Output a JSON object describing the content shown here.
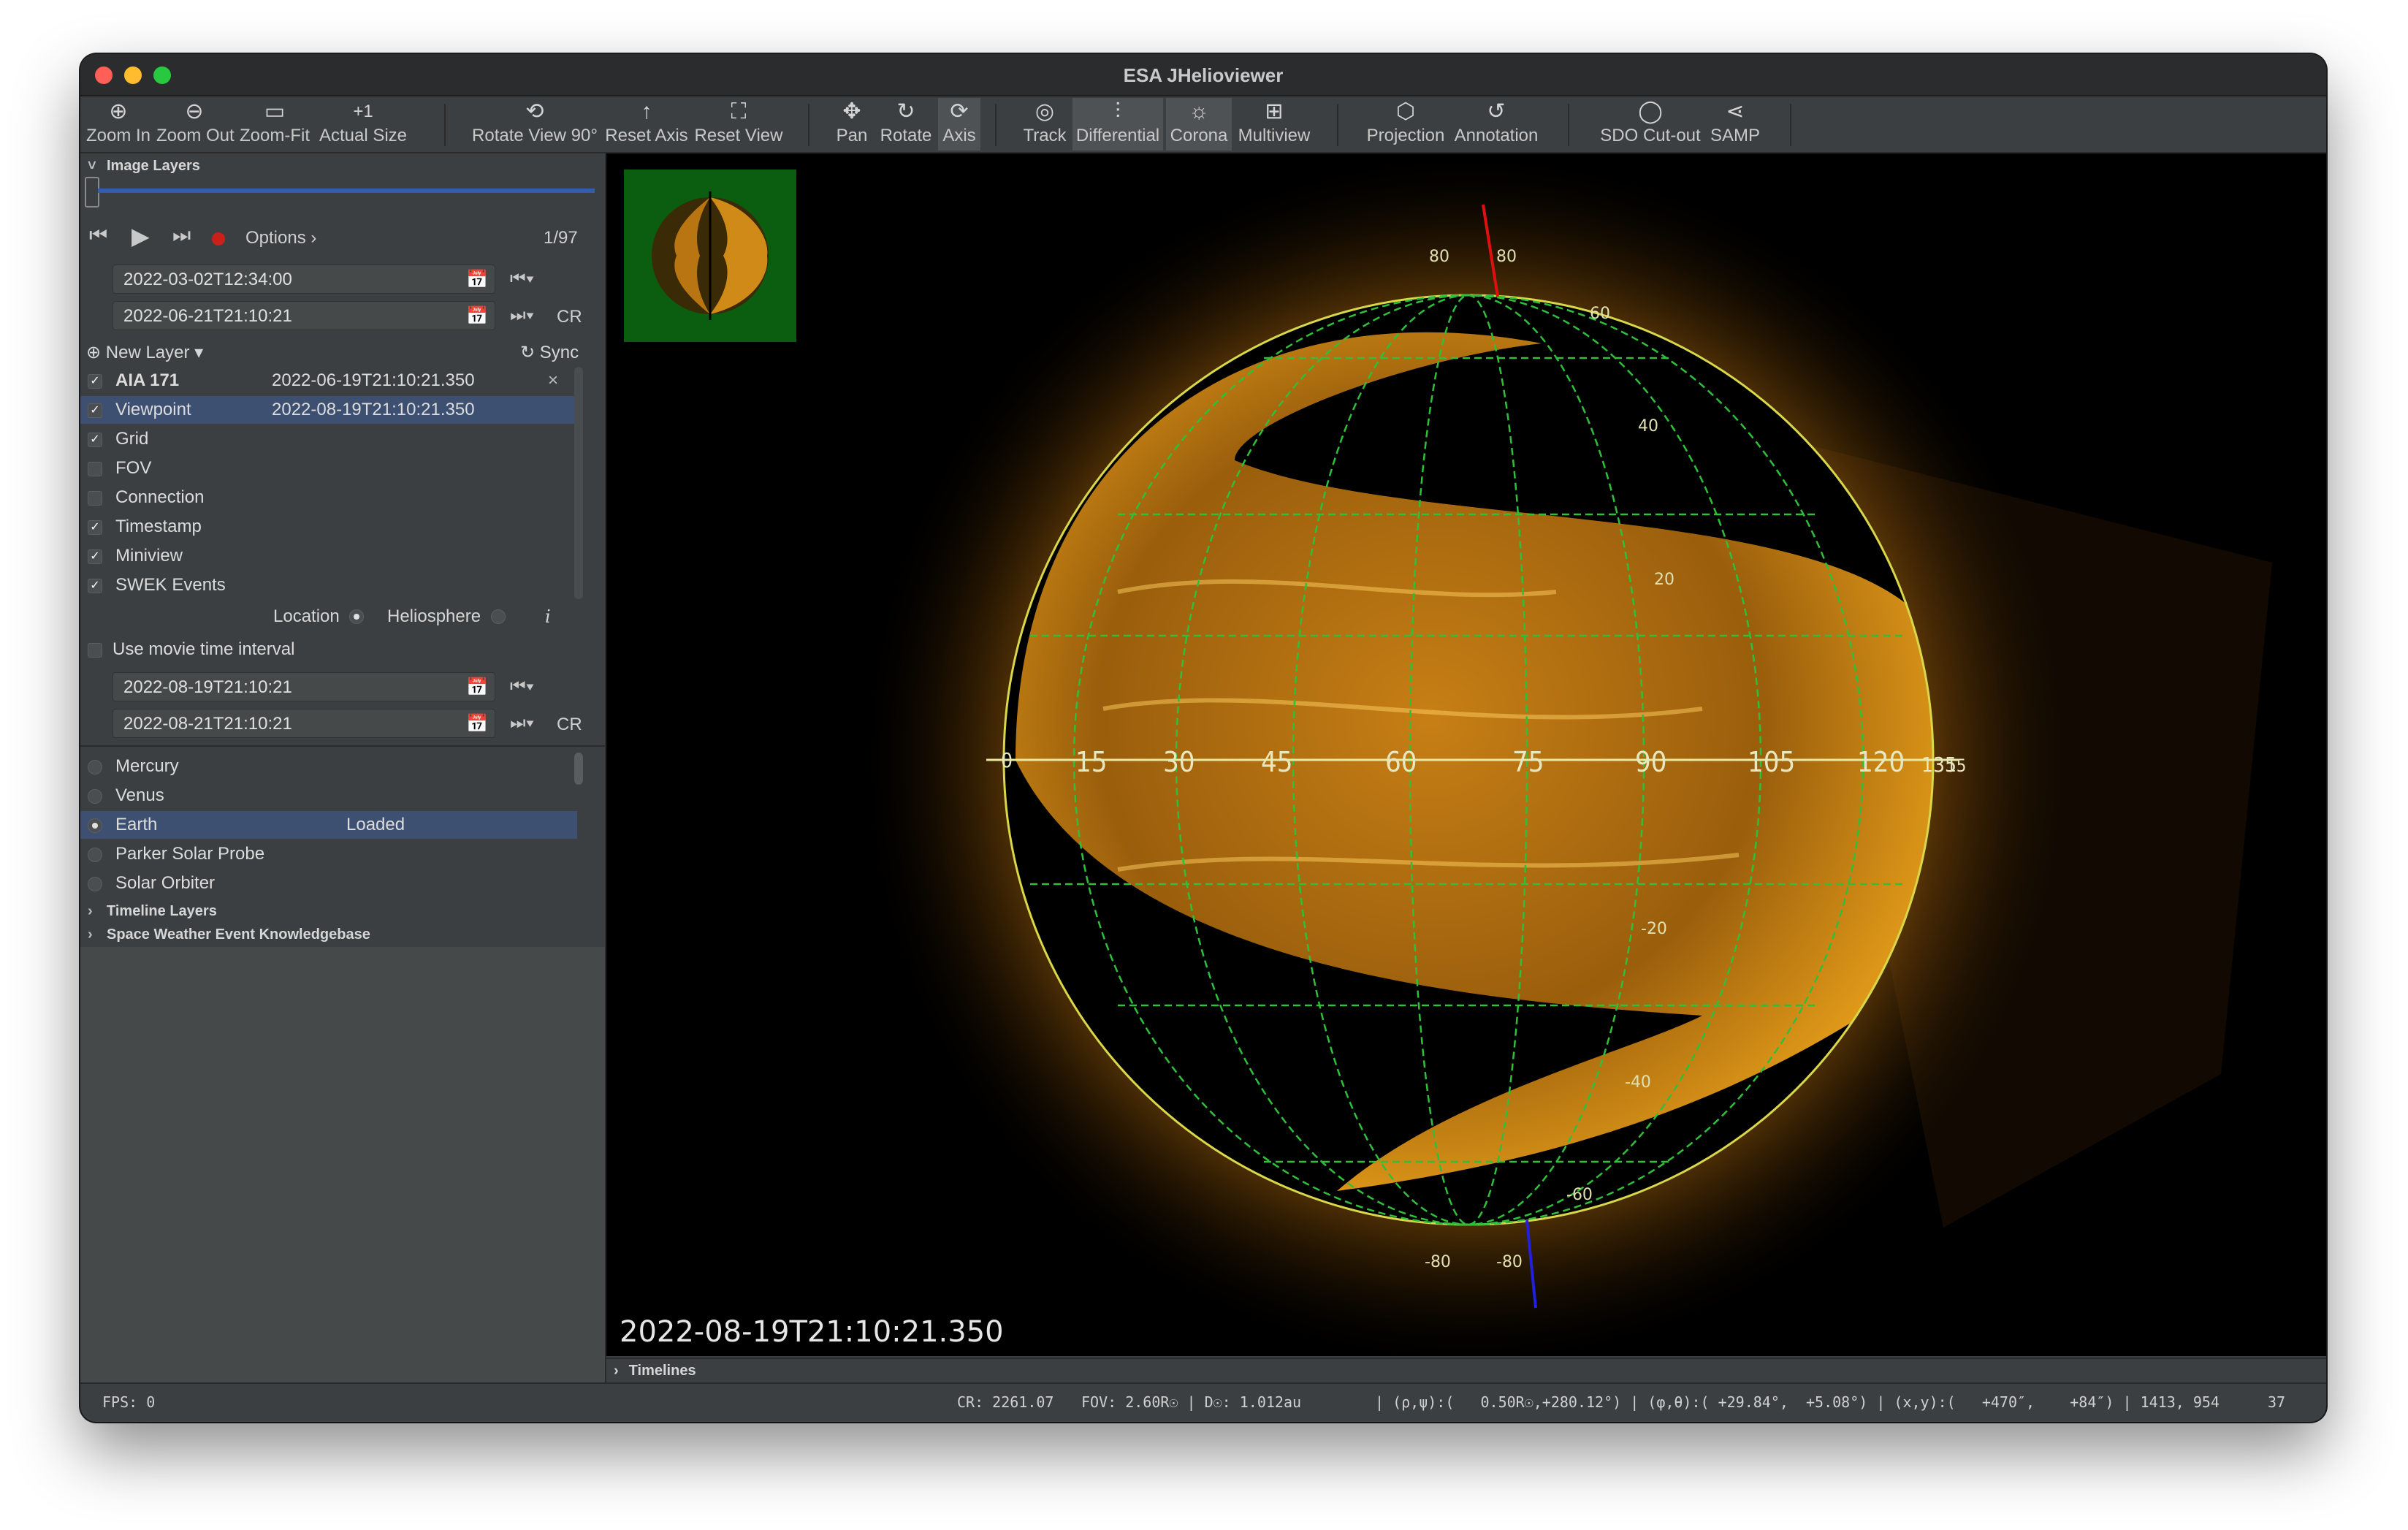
{
  "window": {
    "title": "ESA JHelioviewer"
  },
  "toolbar": {
    "zoom_in": "Zoom In",
    "zoom_out": "Zoom Out",
    "zoom_fit": "Zoom-Fit",
    "actual_size": "Actual Size",
    "rotate_view": "Rotate View 90°",
    "reset_axis": "Reset Axis",
    "reset_view": "Reset View",
    "pan": "Pan",
    "rotate": "Rotate",
    "axis": "Axis",
    "track": "Track",
    "differential": "Differential",
    "corona": "Corona",
    "multiview": "Multiview",
    "projection": "Projection",
    "annotation": "Annotation",
    "sdo_cutout": "SDO Cut-out",
    "samp": "SAMP",
    "actual_size_icon": "+1"
  },
  "image_layers": {
    "header": "Image Layers",
    "options": "Options",
    "frame": "1/97",
    "start": "2022-03-02T12:34:00",
    "end": "2022-06-21T21:10:21",
    "cr": "CR",
    "new_layer": "New Layer",
    "sync": "Sync",
    "layers": [
      {
        "name": "AIA 171",
        "time": "2022-06-19T21:10:21.350",
        "close": "×"
      },
      {
        "name": "Viewpoint",
        "time": "2022-08-19T21:10:21.350"
      },
      {
        "name": "Grid"
      },
      {
        "name": "FOV"
      },
      {
        "name": "Connection"
      },
      {
        "name": "Timestamp"
      },
      {
        "name": "Miniview"
      },
      {
        "name": "SWEK Events"
      }
    ]
  },
  "viewpoint": {
    "location": "Location",
    "heliosphere": "Heliosphere",
    "info": "i",
    "use_movie": "Use movie time interval",
    "start": "2022-08-19T21:10:21",
    "end": "2022-08-21T21:10:21",
    "cr": "CR",
    "bodies": [
      {
        "name": "Mercury",
        "status": ""
      },
      {
        "name": "Venus",
        "status": ""
      },
      {
        "name": "Earth",
        "status": "Loaded"
      },
      {
        "name": "Parker Solar Probe",
        "status": ""
      },
      {
        "name": "Solar Orbiter",
        "status": ""
      }
    ]
  },
  "sections": {
    "timeline_layers": "Timeline Layers",
    "swek": "Space Weather Event Knowledgebase",
    "timelines": "Timelines"
  },
  "viewer": {
    "timestamp": "2022-08-19T21:10:21.350",
    "axis_labels": [
      "0",
      "15",
      "30",
      "45",
      "60",
      "75",
      "90",
      "105",
      "120",
      "135",
      "15"
    ],
    "lat_labels": {
      "top_a": "80",
      "top_b": "80",
      "n60": "60",
      "n40": "40",
      "n20": "20",
      "s20": "-20",
      "s40": "-40",
      "s60": "-60",
      "bot_a": "-80",
      "bot_b": "-80"
    }
  },
  "status": {
    "fps": "FPS:  0",
    "cr": "CR: 2261.07",
    "fov": "FOV:   2.60R☉ | D☉:   1.012au",
    "coords": "| (ρ,ψ):(   0.50R☉,+280.12°) | (φ,θ):( +29.84°,  +5.08°) | (x,y):(   +470″,    +84″) | 1413, 954",
    "count": "37"
  },
  "colors": {
    "accent": "#2e5fa8",
    "sun": "#e8a01a",
    "grid": "#2fbf3a"
  }
}
